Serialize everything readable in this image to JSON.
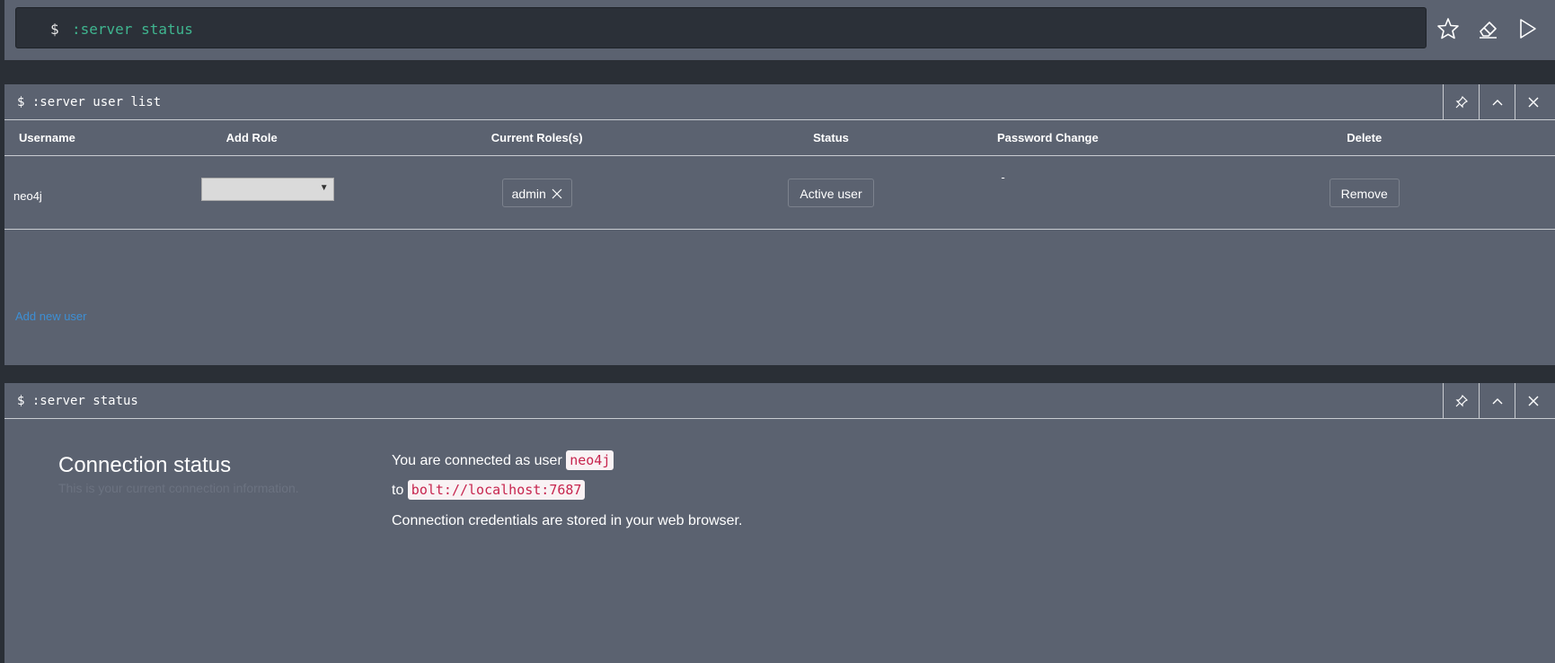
{
  "editor": {
    "prompt": "$",
    "command": ":server status"
  },
  "user_list_frame": {
    "title": "$ :server user list",
    "columns": [
      "Username",
      "Add Role",
      "Current Roles(s)",
      "Status",
      "Password Change",
      "Delete"
    ],
    "rows": [
      {
        "username": "neo4j",
        "add_role_value": "",
        "role": "admin",
        "status": "Active user",
        "password_change": "-",
        "delete_label": "Remove"
      }
    ],
    "add_user_link": "Add new user"
  },
  "status_frame": {
    "title": "$ :server status",
    "heading": "Connection status",
    "subheading": "This is your current connection information.",
    "connected_prefix": "You are connected as user",
    "user": "neo4j",
    "to_prefix": "to",
    "address": "bolt://localhost:7687",
    "credentials_note": "Connection credentials are stored in your web browser."
  },
  "icons": {
    "editor": [
      "star-icon",
      "eraser-icon",
      "play-icon"
    ],
    "frame_controls": [
      "pin-icon",
      "chevron-up-icon",
      "close-icon"
    ]
  },
  "colors": {
    "background": "#2a2f36",
    "frame": "#5b6270",
    "command": "#3fb58f",
    "link": "#3d8fd4",
    "code_text": "#c7254e",
    "code_bg": "#f9f2f4"
  }
}
